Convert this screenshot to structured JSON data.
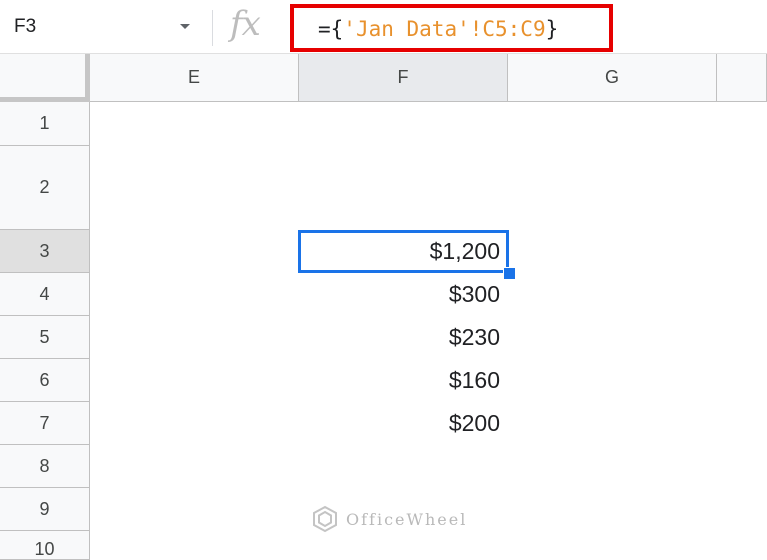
{
  "formula_bar": {
    "name_box": "F3",
    "fx_label": "fx",
    "formula_prefix": "={",
    "formula_ref": "'Jan Data'!C5:C9",
    "formula_suffix": "}"
  },
  "columns": [
    "E",
    "F",
    "G"
  ],
  "rows": [
    "1",
    "2",
    "3",
    "4",
    "5",
    "6",
    "7",
    "8",
    "9",
    "10"
  ],
  "cells": {
    "F3": "$1,200",
    "F4": "$300",
    "F5": "$230",
    "F6": "$160",
    "F7": "$200"
  },
  "selected_cell": "F3",
  "watermark": "OfficeWheel",
  "colors": {
    "selection": "#1a73e8",
    "formula_highlight": "#e60000",
    "range_reference": "#e8912d"
  }
}
